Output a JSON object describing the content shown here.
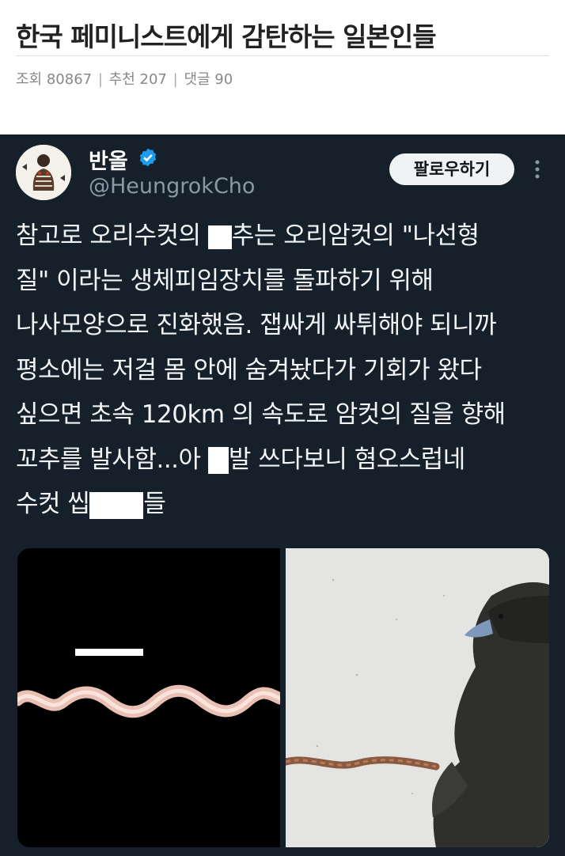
{
  "post": {
    "title": "한국 페미니스트에게 감탄하는 일본인들",
    "meta": {
      "views_label": "조회",
      "views": "80867",
      "likes_label": "추천",
      "likes": "207",
      "comments_label": "댓글",
      "comments": "90"
    }
  },
  "tweet": {
    "display_name": "반올",
    "handle": "@HeungrokCho",
    "follow_label": "팔로우하기",
    "icons": [
      "avatar",
      "verified-badge-icon",
      "more-options-icon"
    ],
    "colors": {
      "background": "#15202b",
      "verified": "#1d9bf0",
      "follow_button": "#eff3f4",
      "handle": "#8b98a5"
    },
    "lines": [
      [
        "참고로 오리수컷의 ",
        "",
        "추는 오리암컷의 \"나선형"
      ],
      [
        "질\" 이라는 생체피임장치를 돌파하기 위해"
      ],
      [
        "나사모양으로 진화했음. 잽싸게 싸튀해야 되니까"
      ],
      [
        "평소에는 저걸 몸 안에 숨겨놨다가 기회가 왔다"
      ],
      [
        "싶으면 초속 120km 의 속도로 암컷의 질을 향해"
      ],
      [
        "꼬추를 발사함...아 ",
        "",
        "발 쓰다보니 혐오스럽네"
      ],
      [
        "수컷 씹",
        "",
        "들"
      ]
    ],
    "media": [
      "spiral-specimen-image",
      "duck-image"
    ]
  }
}
